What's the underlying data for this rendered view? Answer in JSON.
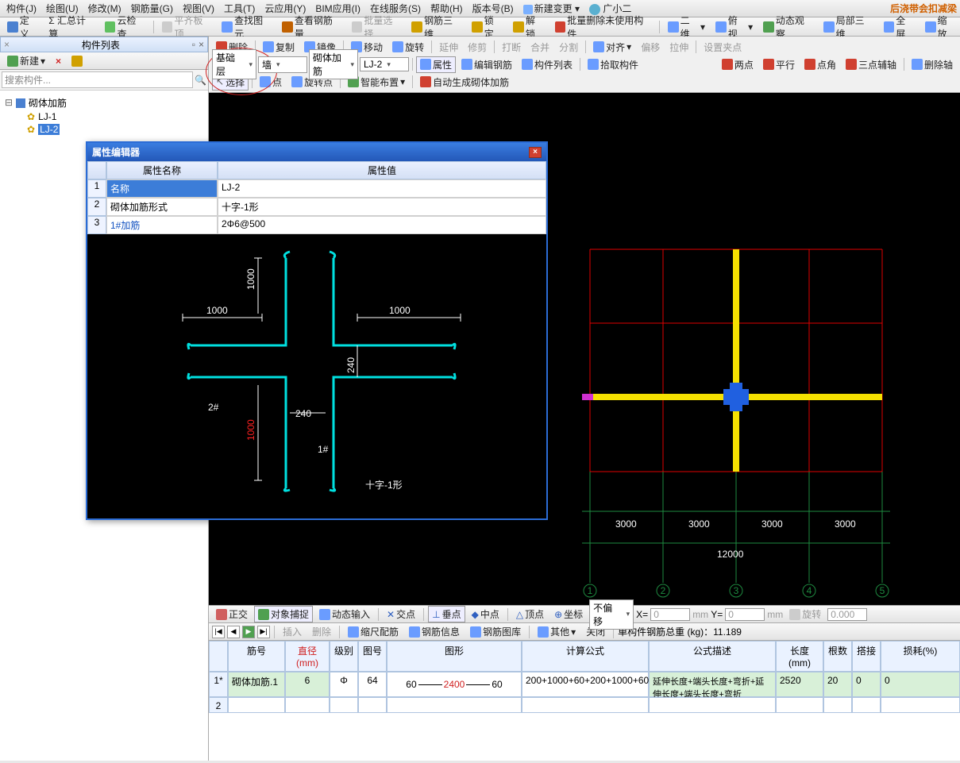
{
  "menubar": [
    "构件(J)",
    "绘图(U)",
    "修改(M)",
    "钢筋量(G)",
    "视图(V)",
    "工具(T)",
    "云应用(Y)",
    "BIM应用(I)",
    "在线服务(S)",
    "帮助(H)",
    "版本号(B)"
  ],
  "menubtns": {
    "new_change": "新建变更",
    "user": "广小二",
    "warn": "后浇带会扣减梁"
  },
  "toolbar1": [
    "定义",
    "Σ 汇总计算",
    "云检查",
    "平齐板顶",
    "查找图元",
    "查看钢筋量",
    "批量选择",
    "钢筋三维",
    "锁定",
    "解锁",
    "批量删除未使用构件",
    "二维",
    "俯视",
    "动态观察",
    "局部三维",
    "全屏",
    "缩放"
  ],
  "dock": {
    "title": "构件列表",
    "pin": "□",
    "close": "×"
  },
  "sidebar": {
    "new": "新建",
    "search_ph": "搜索构件...",
    "tree_root": "砌体加筋",
    "items": [
      "LJ-1",
      "LJ-2"
    ],
    "selected": "LJ-2"
  },
  "ribbon": {
    "row1": [
      "删除",
      "复制",
      "镜像",
      "移动",
      "旋转",
      "延伸",
      "修剪",
      "打断",
      "合并",
      "分割",
      "对齐",
      "偏移",
      "拉伸",
      "设置夹点"
    ],
    "combo_floor": "基础层",
    "combo_wall": "墙",
    "combo_type": "砌体加筋",
    "combo_item": "LJ-2",
    "row2_btns": [
      "属性",
      "编辑钢筋",
      "构件列表",
      "拾取构件"
    ],
    "row2_right": [
      "两点",
      "平行",
      "点角",
      "三点辅轴",
      "删除轴"
    ],
    "row3": [
      "选择",
      "点",
      "旋转点",
      "智能布置",
      "自动生成砌体加筋"
    ]
  },
  "dialog": {
    "title": "属性编辑器",
    "col1": "属性名称",
    "col2": "属性值",
    "rows": [
      [
        "1",
        "名称",
        "LJ-2"
      ],
      [
        "2",
        "砌体加筋形式",
        "十字-1形"
      ],
      [
        "3",
        "1#加筋",
        "2Φ6@500"
      ]
    ],
    "diagram_labels": {
      "l1000": "1000",
      "l240": "240",
      "tag1": "1#",
      "tag2": "2#",
      "title": "十字-1形"
    }
  },
  "grid": {
    "dims": [
      "3000",
      "3000",
      "3000",
      "3000"
    ],
    "total": "12000",
    "axes": [
      "1",
      "2",
      "3",
      "4",
      "5"
    ]
  },
  "status": {
    "items": [
      "正交",
      "对象捕捉",
      "动态输入",
      "交点",
      "垂点",
      "中点",
      "顶点",
      "坐标"
    ],
    "combo": "不偏移",
    "x": "X=",
    "y": "Y=",
    "unit": "mm",
    "rot": "旋转",
    "rotval": "0.000"
  },
  "bottombar": {
    "items": [
      "插入",
      "删除",
      "缩尺配筋",
      "钢筋信息",
      "钢筋图库",
      "其他",
      "关闭"
    ],
    "weight": "单构件钢筋总重 (kg)：11.189"
  },
  "table": {
    "hdrs": [
      "筋号",
      "直径(mm)",
      "级别",
      "图号",
      "图形",
      "计算公式",
      "公式描述",
      "长度(mm)",
      "根数",
      "搭接",
      "损耗(%)"
    ],
    "row": {
      "n": "1*",
      "name": "砌体加筋.1",
      "d": "6",
      "grade": "Φ",
      "fig": "64",
      "shape_l": "60",
      "shape_m": "2400",
      "shape_r": "60",
      "formula": "200+1000+60+200+1000+60",
      "desc": "延伸长度+端头长度+弯折+延伸长度+端头长度+弯折",
      "len": "2520",
      "count": "20",
      "lap": "0",
      "loss": "0"
    },
    "row2n": "2"
  }
}
